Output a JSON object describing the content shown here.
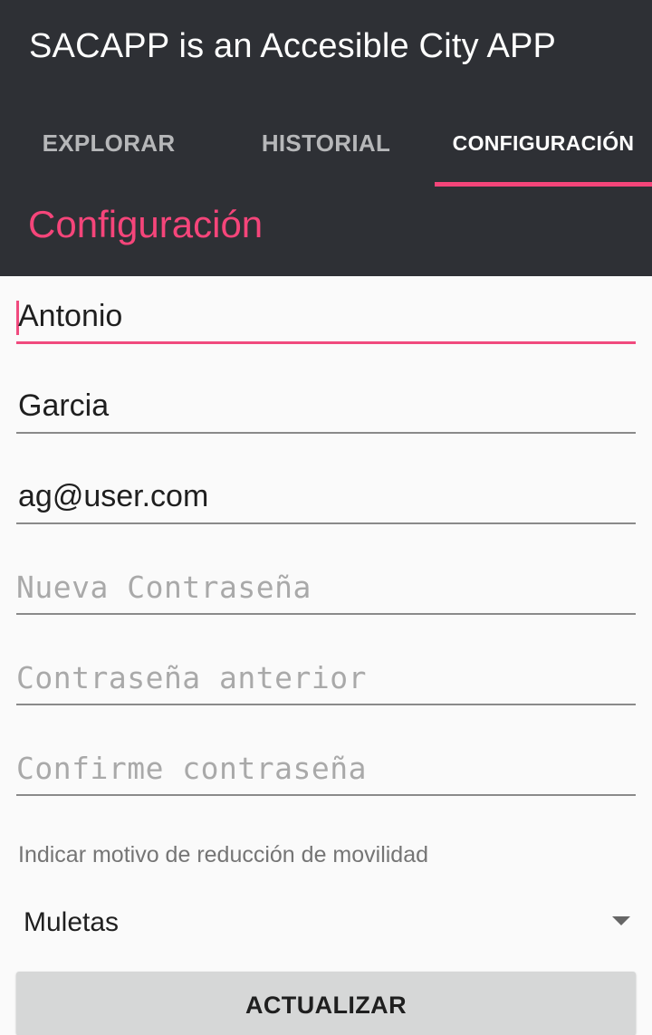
{
  "app": {
    "title": "SACAPP is an Accesible City APP",
    "accent_color": "#f5457a",
    "bar_color": "#2e3035"
  },
  "tabs": [
    {
      "label": "EXPLORAR",
      "active": false
    },
    {
      "label": "HISTORIAL",
      "active": false
    },
    {
      "label": "CONFIGURACIÓN",
      "active": true
    }
  ],
  "section": {
    "title": "Configuración"
  },
  "form": {
    "first_name": {
      "value": "Antonio"
    },
    "last_name": {
      "value": "Garcia"
    },
    "email": {
      "value": "ag@user.com"
    },
    "new_password": {
      "placeholder": "Nueva Contraseña"
    },
    "old_password": {
      "placeholder": "Contraseña anterior"
    },
    "confirm_password": {
      "placeholder": "Confirme contraseña"
    },
    "mobility_reason": {
      "label": "Indicar motivo de reducción de movilidad",
      "selected": "Muletas"
    },
    "update_button": {
      "label": "ACTUALIZAR"
    }
  }
}
